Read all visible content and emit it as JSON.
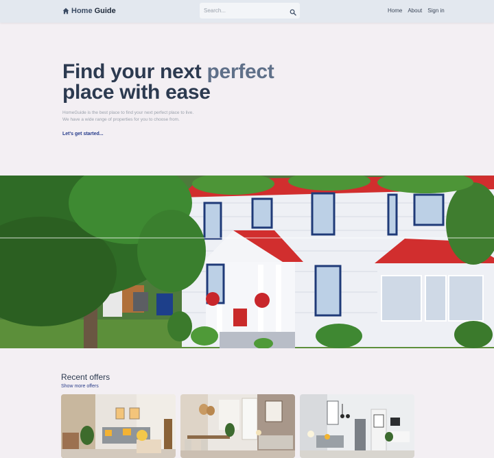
{
  "navbar": {
    "brand_part1": "Home",
    "brand_part2": "Guide",
    "brand_icon": "house-icon",
    "search_placeholder": "Search...",
    "search_icon": "search-icon",
    "links": [
      "Home",
      "About",
      "Sign in"
    ]
  },
  "hero": {
    "title_line1_a": "Find your next ",
    "title_line1_b": "perfect",
    "title_line2": "place with ease",
    "description_line1": "HomeGuide is the best place to find your next perfect place to live.",
    "description_line2": "We have a wide range of properties for you to choose from.",
    "cta": "Let's get started..."
  },
  "banner": {
    "image": "house-with-trees-photo"
  },
  "offers": {
    "title": "Recent offers",
    "link": "Show more offers",
    "cards": [
      {
        "image": "living-room-photo"
      },
      {
        "image": "dining-living-room-photo"
      },
      {
        "image": "modern-living-room-photo"
      }
    ]
  },
  "colors": {
    "navbar_bg": "#e3e8ef",
    "page_bg": "#f3eff3",
    "title": "#2c3a50",
    "accent": "#5f7089",
    "link": "#243a8a"
  }
}
